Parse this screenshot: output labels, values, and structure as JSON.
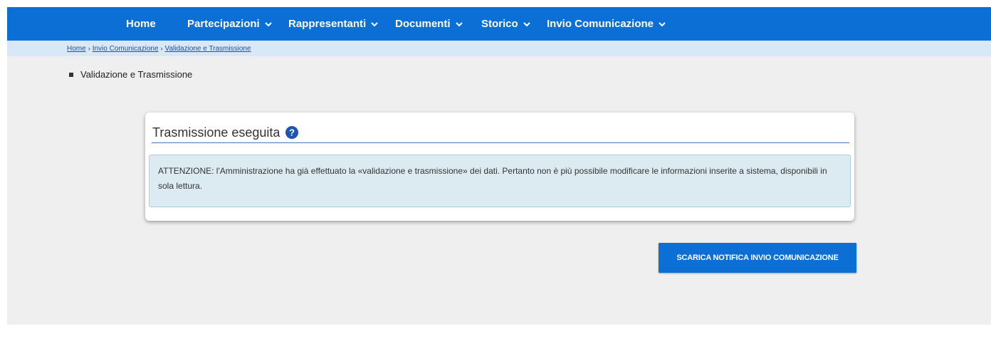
{
  "navbar": {
    "items": [
      {
        "label": "Home",
        "dropdown": false
      },
      {
        "label": "Partecipazioni",
        "dropdown": true
      },
      {
        "label": "Rappresentanti",
        "dropdown": true
      },
      {
        "label": "Documenti",
        "dropdown": true
      },
      {
        "label": "Storico",
        "dropdown": true
      },
      {
        "label": "Invio Comunicazione",
        "dropdown": true
      }
    ],
    "color": "#0b6fd6"
  },
  "breadcrumb": {
    "items": [
      "Home",
      "Invio Comunicazione",
      "Validazione e Trasmissione"
    ],
    "separator": "›"
  },
  "page": {
    "heading": "Validazione e Trasmissione"
  },
  "card": {
    "title": "Trasmissione eseguita",
    "help_icon": "question-circle-icon",
    "alert_text": "ATTENZIONE: l'Amministrazione ha già effettuato la «validazione e trasmissione» dei dati. Pertanto non è più possibile modificare le informazioni inserite a sistema, disponibili in sola lettura."
  },
  "actions": {
    "download_label": "SCARICA NOTIFICA INVIO COMUNICAZIONE"
  }
}
